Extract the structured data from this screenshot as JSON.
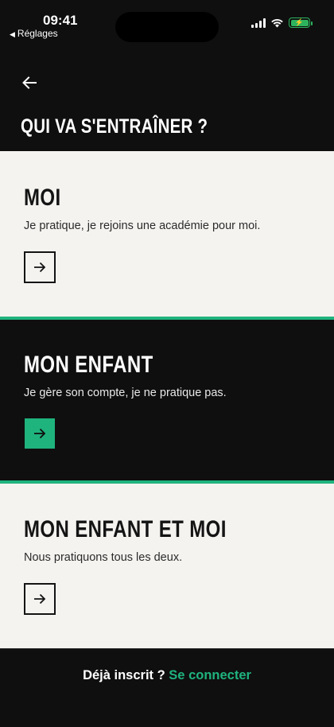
{
  "status_bar": {
    "time": "09:41",
    "back_app": "Réglages",
    "battery_color": "#2db35d"
  },
  "header": {
    "title": "QUI VA S'ENTRAÎNER ?",
    "back_icon": "arrow-left-icon"
  },
  "options": [
    {
      "title": "MOI",
      "description": "Je pratique, je rejoins une académie pour moi.",
      "theme": "light",
      "button_style": "outline",
      "icon": "arrow-right-icon"
    },
    {
      "title": "MON ENFANT",
      "description": "Je gère son compte, je ne pratique pas.",
      "theme": "dark",
      "button_style": "filled",
      "icon": "arrow-right-icon"
    },
    {
      "title": "MON ENFANT ET MOI",
      "description": "Nous pratiquons tous les deux.",
      "theme": "light",
      "button_style": "outline",
      "icon": "arrow-right-icon"
    }
  ],
  "footer": {
    "question": "Déjà inscrit ?",
    "link_label": "Se connecter"
  },
  "colors": {
    "accent": "#1fb37e",
    "dark_bg": "#0f0f0f",
    "light_bg": "#f5f3f0"
  }
}
